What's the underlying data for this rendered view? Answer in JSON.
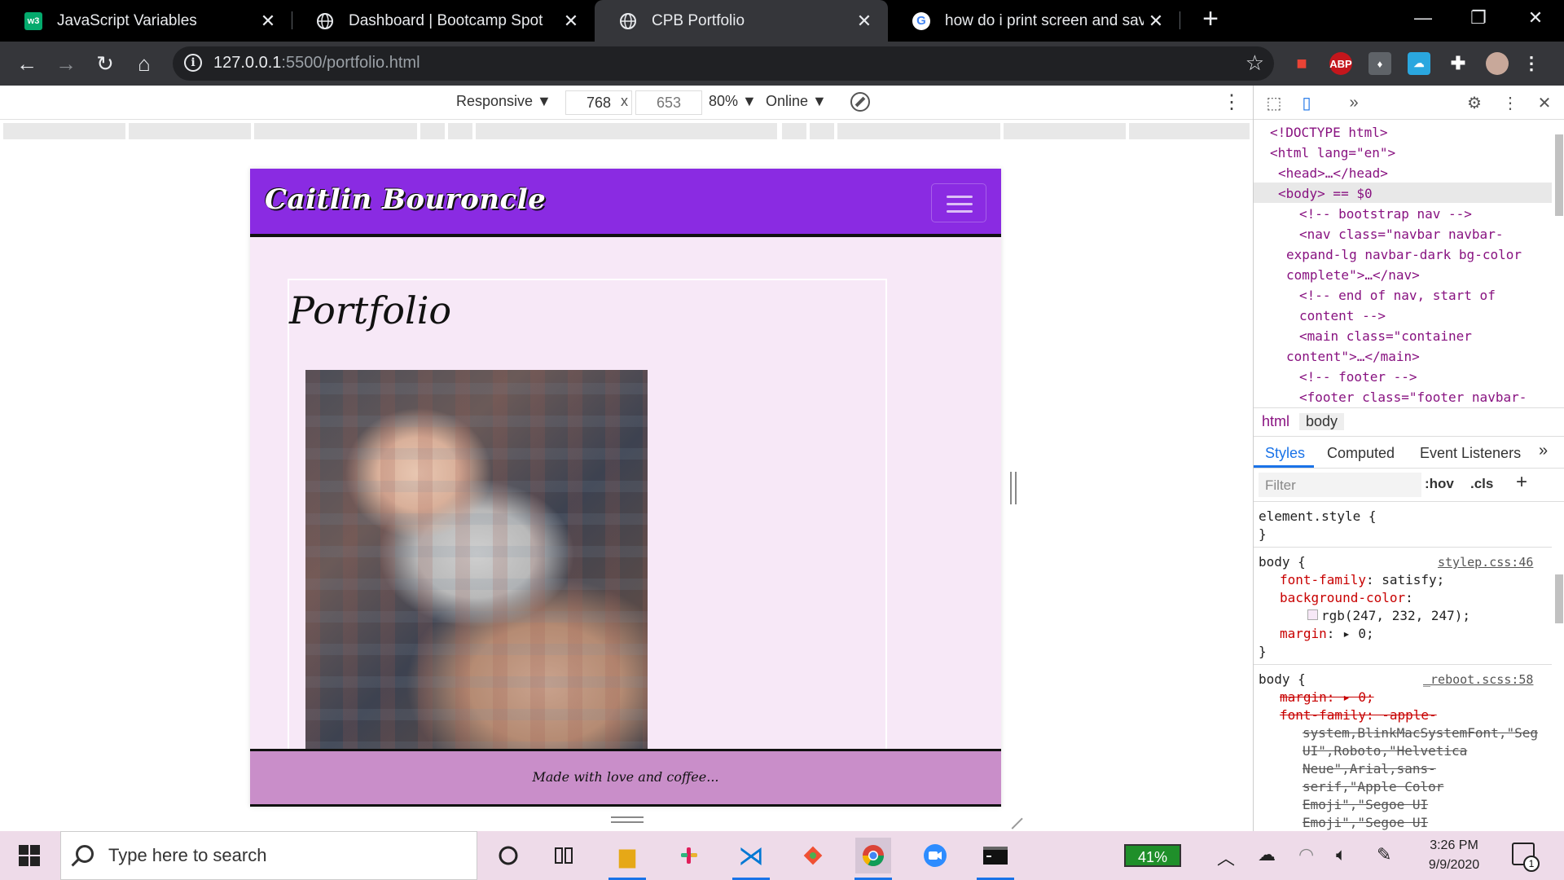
{
  "tabs": [
    {
      "title": "JavaScript Variables",
      "close": "✕",
      "favicon": "w3-icon"
    },
    {
      "title": "Dashboard | Bootcamp Spot",
      "close": "✕",
      "favicon": "globe-icon"
    },
    {
      "title": "CPB Portfolio",
      "close": "✕",
      "favicon": "globe-icon"
    },
    {
      "title": "how do i print screen and save to",
      "close": "✕",
      "favicon": "google-icon"
    }
  ],
  "window": {
    "new_tab": "+",
    "minimize": "—",
    "restore": "❐",
    "close": "✕"
  },
  "address": {
    "host": "127.0.0.1",
    "rest": ":5500/portfolio.html"
  },
  "extensions": {
    "abp": "ABP"
  },
  "device_toolbar": {
    "mode": "Responsive ▼",
    "width": "768",
    "times": "x",
    "height": "653",
    "zoom": "80% ▼",
    "network": "Online ▼"
  },
  "site": {
    "brand": "Caitlin Bouroncle",
    "heading": "Portfolio",
    "footer": "Made with love and coffee..."
  },
  "devtools": {
    "tree": [
      "<!DOCTYPE html>",
      "<html lang=\"en\">",
      "<head>…</head>",
      "<body> == $0",
      "<!-- bootstrap nav -->",
      "<nav class=\"navbar navbar-",
      "expand-lg navbar-dark bg-color",
      "complete\">…</nav>",
      "<!-- end of nav, start of",
      "content -->",
      "<main class=\"container",
      "content\">…</main>",
      "<!-- footer -->",
      "<footer class=\"footer navbar-"
    ],
    "crumbs": [
      "html",
      "body"
    ],
    "panel_tabs": [
      "Styles",
      "Computed",
      "Event Listeners"
    ],
    "filter_placeholder": "Filter",
    "hov": ":hov",
    "cls": ".cls",
    "styles": {
      "element_style": "element.style {",
      "close_brace": "}",
      "body_selector": "body {",
      "source1": "stylep.css:46",
      "prop_font_family": "font-family",
      "val_font_family": ": satisfy;",
      "prop_background": "background-color",
      "val_background": "rgb(247, 232, 247);",
      "prop_margin": "margin",
      "val_margin": ": ▸ 0;",
      "source2": "_reboot.scss:58",
      "strike_margin": "margin: ▸ 0;",
      "strike_font": "font-family: -apple-",
      "strike_lines": [
        "system,BlinkMacSystemFont,\"Seg",
        "UI\",Roboto,\"Helvetica",
        "Neue\",Arial,sans-",
        "serif,\"Apple Color",
        "Emoji\",\"Segoe UI",
        "Emoji\",\"Segoe UI"
      ]
    }
  },
  "taskbar": {
    "search_placeholder": "Type here to search",
    "battery": "41%",
    "time": "3:26 PM",
    "date": "9/9/2020",
    "notif_count": "1"
  },
  "colors": {
    "navbar": "#8a2be2",
    "page_bg": "#f7e8f7",
    "footer": "#c98ec9"
  }
}
